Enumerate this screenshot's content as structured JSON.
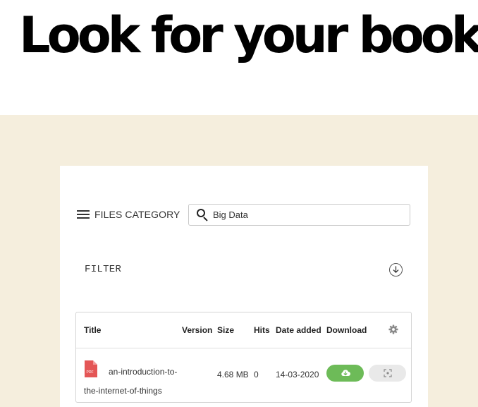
{
  "hero": {
    "title": "Look for your book"
  },
  "toolbar": {
    "category_label": "FILES CATEGORY",
    "search_value": "Big Data"
  },
  "filter": {
    "label": "FILTER"
  },
  "table": {
    "headers": {
      "title": "Title",
      "version": "Version",
      "size": "Size",
      "hits": "Hits",
      "date_added": "Date added",
      "download": "Download"
    },
    "rows": [
      {
        "title": "an-introduction-to-the-internet-of-things",
        "file_type": "PDF",
        "version": "",
        "size": "4.68 MB",
        "hits": "0",
        "date_added": "14-03-2020"
      }
    ]
  },
  "colors": {
    "band_background": "#f5eedd",
    "download_button": "#6dbb58",
    "pdf_icon": "#e45656"
  },
  "icons": {
    "menu": "hamburger-menu-icon",
    "search": "search-icon",
    "filter_toggle": "circle-arrow-down-icon",
    "settings": "gear-icon",
    "file": "pdf-file-icon",
    "download": "cloud-download-icon",
    "preview": "scan-preview-icon"
  }
}
